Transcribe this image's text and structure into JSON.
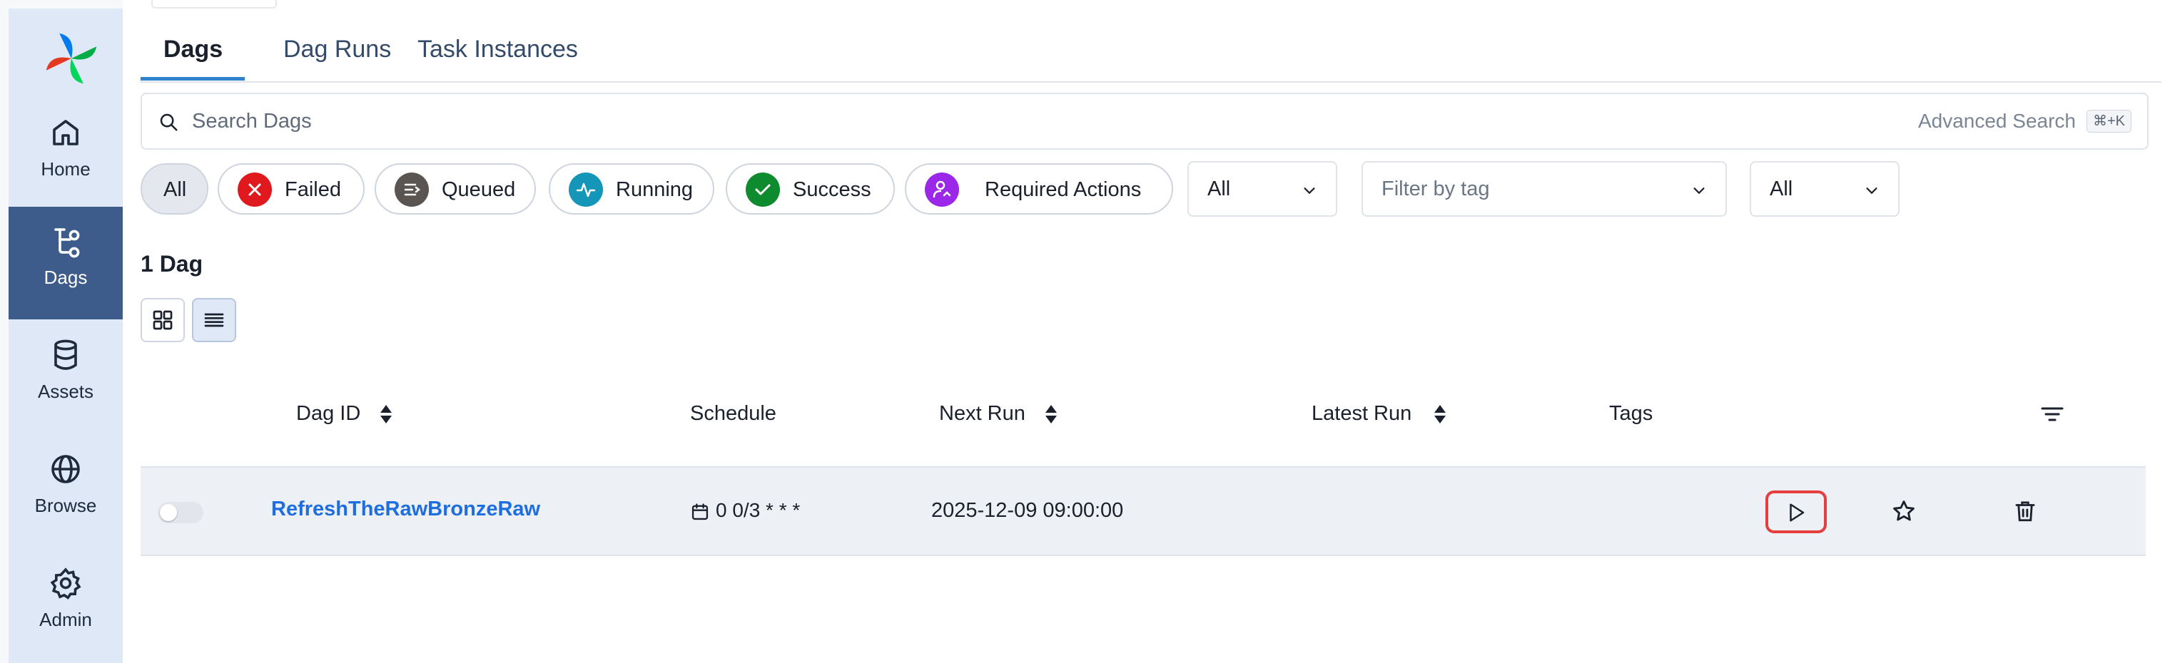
{
  "sidebar": {
    "items": [
      {
        "label": "Home",
        "icon": "home-icon"
      },
      {
        "label": "Dags",
        "icon": "dags-icon",
        "active": true
      },
      {
        "label": "Assets",
        "icon": "database-icon"
      },
      {
        "label": "Browse",
        "icon": "globe-icon"
      },
      {
        "label": "Admin",
        "icon": "gear-icon"
      }
    ]
  },
  "tabs": [
    {
      "label": "Dags",
      "active": true
    },
    {
      "label": "Dag Runs"
    },
    {
      "label": "Task Instances"
    }
  ],
  "search": {
    "placeholder": "Search Dags",
    "advanced_label": "Advanced Search",
    "shortcut": "⌘+K"
  },
  "filters": {
    "state_chips": [
      {
        "label": "All",
        "selected": true
      },
      {
        "label": "Failed",
        "color": "#e0191f",
        "icon": "x-icon"
      },
      {
        "label": "Queued",
        "color": "#5b5552",
        "icon": "queue-icon"
      },
      {
        "label": "Running",
        "color": "#1595b7",
        "icon": "activity-icon"
      },
      {
        "label": "Success",
        "color": "#0e8a2f",
        "icon": "check-icon"
      },
      {
        "label": "Required Actions",
        "color": "#9b27e8",
        "icon": "user-action-icon"
      }
    ],
    "paused_select": "All",
    "tag_select_placeholder": "Filter by tag",
    "tag_mode_select": "All"
  },
  "results": {
    "count_label": "1 Dag"
  },
  "table": {
    "headers": {
      "dag_id": "Dag ID",
      "schedule": "Schedule",
      "next_run": "Next Run",
      "latest_run": "Latest Run",
      "tags": "Tags"
    },
    "rows": [
      {
        "dag_id": "RefreshTheRawBronzeRaw",
        "schedule": "0 0/3 * * *",
        "next_run": "2025-12-09 09:00:00",
        "latest_run": "",
        "tags": "",
        "paused": true
      }
    ]
  },
  "colors": {
    "accent": "#3182ce",
    "sidebar_bg": "#dfe8f6",
    "sidebar_active": "#3d5c8c",
    "link": "#1f6ee0",
    "highlight_outline": "#e53e3e"
  }
}
